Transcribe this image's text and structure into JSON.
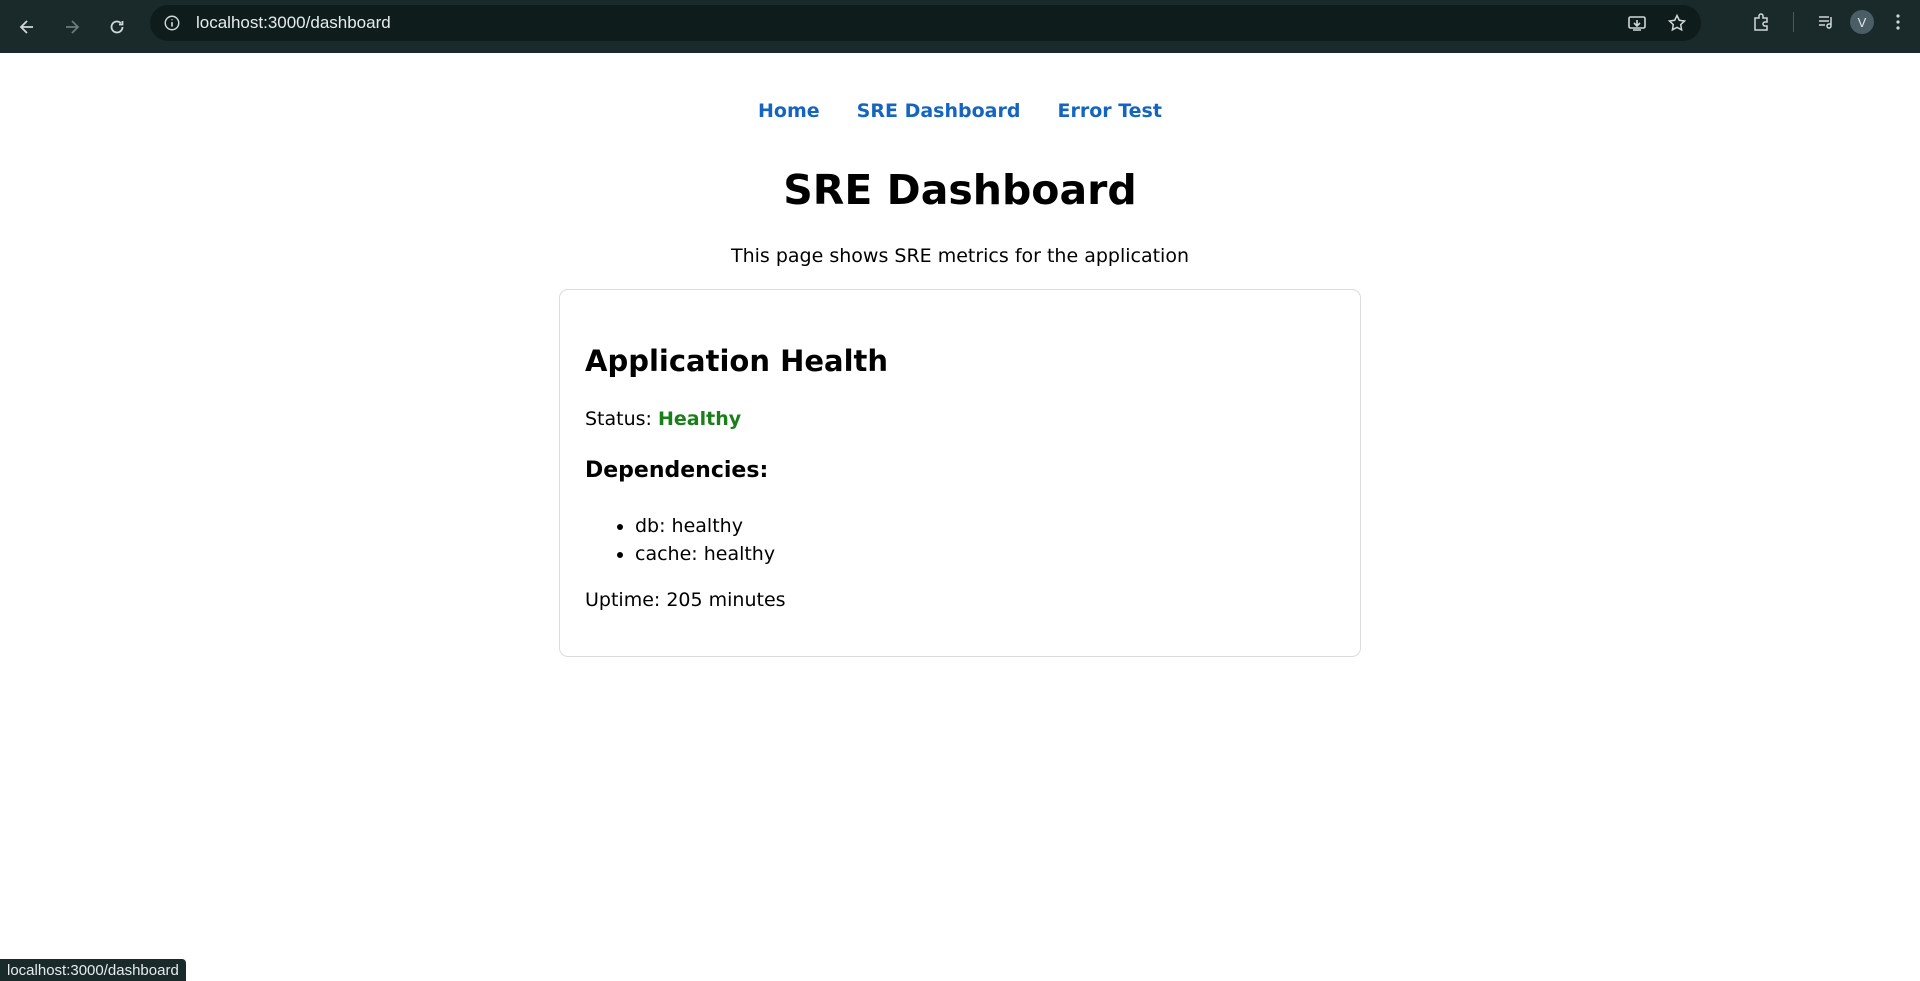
{
  "browser": {
    "url": "localhost:3000/dashboard",
    "avatar_letter": "V",
    "status_url": "localhost:3000/dashboard"
  },
  "nav": {
    "items": [
      {
        "label": "Home"
      },
      {
        "label": "SRE Dashboard"
      },
      {
        "label": "Error Test"
      }
    ],
    "link_color": "#1565c0"
  },
  "page": {
    "title": "SRE Dashboard",
    "description": "This page shows SRE metrics for the application"
  },
  "health": {
    "heading": "Application Health",
    "status_label": "Status:",
    "status_value": "Healthy",
    "status_color": "#1a7f1a",
    "dependencies_heading": "Dependencies:",
    "dependencies": [
      {
        "text": "db: healthy"
      },
      {
        "text": "cache: healthy"
      }
    ],
    "uptime": "Uptime: 205 minutes"
  }
}
